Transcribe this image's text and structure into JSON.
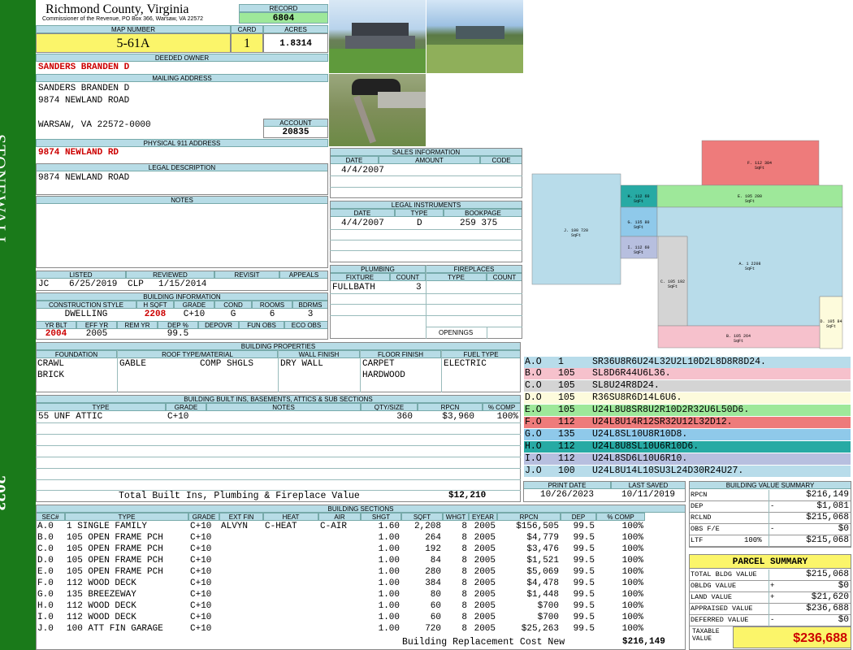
{
  "header": {
    "county": "Richmond County, Virginia",
    "commissioner": "Commissioner of the Revenue, PO Box 366, Warsaw, VA 22572",
    "record_label": "RECORD",
    "record": "6804",
    "map_label": "MAP NUMBER",
    "map_number": "5-61A",
    "card_label": "CARD",
    "card": "1",
    "acres_label": "ACRES",
    "acres": "1.8314"
  },
  "sidebar": {
    "district": "STONEWALL",
    "year": "2023"
  },
  "owner": {
    "owner_label": "DEEDED OWNER",
    "owner": "SANDERS BRANDEN D",
    "mailing_label": "MAILING ADDRESS",
    "mail1": "SANDERS BRANDEN D",
    "mail2": "9874 NEWLAND ROAD",
    "mail3": "WARSAW, VA 22572-0000",
    "account_label": "ACCOUNT",
    "account": "20835",
    "physical_label": "PHYSICAL 911 ADDRESS",
    "physical": "9874 NEWLAND RD",
    "legal_label": "LEGAL DESCRIPTION",
    "legal": "9874 NEWLAND ROAD",
    "notes_label": "NOTES"
  },
  "sales": {
    "title": "SALES INFORMATION",
    "cols": [
      "DATE",
      "AMOUNT",
      "CODE"
    ],
    "date": "4/4/2007"
  },
  "legal_instruments": {
    "title": "LEGAL INSTRUMENTS",
    "cols": [
      "DATE",
      "TYPE",
      "BOOKPAGE"
    ],
    "date": "4/4/2007",
    "type": "D",
    "bookpage": "259 375"
  },
  "plumbing": {
    "title": "PLUMBING",
    "cols": [
      "FIXTURE",
      "COUNT"
    ],
    "fixture": "FULLBATH",
    "count": "3"
  },
  "fireplaces": {
    "title": "FIREPLACES",
    "cols": [
      "TYPE",
      "COUNT"
    ],
    "openings": "OPENINGS"
  },
  "listing": {
    "listed_label": "LISTED",
    "listed_by": "JC",
    "listed_date": "6/25/2019",
    "reviewed_label": "REVIEWED",
    "reviewed_by": "CLP",
    "reviewed_date": "1/15/2014",
    "revisit_label": "REVISIT",
    "appeals_label": "APPEALS"
  },
  "building_info": {
    "title": "BUILDING INFORMATION",
    "cols": [
      "CONSTRUCTION STYLE",
      "H SQFT",
      "GRADE",
      "COND",
      "ROOMS",
      "BDRMS"
    ],
    "style": "DWELLING",
    "hsqft": "2208",
    "grade": "C+10",
    "cond": "G",
    "rooms": "6",
    "bdrms": "3",
    "cols2": [
      "YR BLT",
      "EFF YR",
      "REM YR",
      "DEP %",
      "DEPOVR",
      "FUN OBS",
      "ECO OBS"
    ],
    "yr_blt": "2004",
    "eff_yr": "2005",
    "dep": "99.5"
  },
  "properties": {
    "title": "BUILDING PROPERTIES",
    "cols": [
      "FOUNDATION",
      "ROOF TYPE/MATERIAL",
      "WALL FINISH",
      "FLOOR FINISH",
      "FUEL TYPE"
    ],
    "foundation1": "CRAWL",
    "foundation2": "BRICK",
    "roof_type": "GABLE",
    "roof_mat": "COMP SHGLS",
    "wall": "DRY WALL",
    "floor1": "CARPET",
    "floor2": "HARDWOOD",
    "fuel": "ELECTRIC"
  },
  "builtins": {
    "title": "BUILDING BUILT INS, BASEMENTS, ATTICS & SUB SECTIONS",
    "cols": [
      "TYPE",
      "GRADE",
      "NOTES",
      "QTY/SIZE",
      "RPCN",
      "% COMP"
    ],
    "row": {
      "type": "55 UNF ATTIC",
      "grade": "C+10",
      "qty": "360",
      "rpcn": "$3,960",
      "comp": "100%"
    },
    "total_label": "Total Built Ins, Plumbing & Fireplace Value",
    "total": "$12,210"
  },
  "dates": {
    "print_label": "PRINT DATE",
    "print": "10/26/2023",
    "saved_label": "LAST SAVED",
    "saved": "10/11/2019"
  },
  "segments": [
    {
      "code": "A.O",
      "type": "1",
      "vectors": "SR36U8R6U24L32U2L10D2L8D8R8D24.",
      "color": "#b8dcea"
    },
    {
      "code": "B.O",
      "type": "105",
      "vectors": "SL8D6R44U6L36.",
      "color": "#f6c1cc"
    },
    {
      "code": "C.O",
      "type": "105",
      "vectors": "SL8U24R8D24.",
      "color": "#d4d4d4"
    },
    {
      "code": "D.O",
      "type": "105",
      "vectors": "R36SU8R6D14L6U6.",
      "color": "#fdfbdc"
    },
    {
      "code": "E.O",
      "type": "105",
      "vectors": "U24L8U8SR8U2R10D2R32U6L50D6.",
      "color": "#9ee89a"
    },
    {
      "code": "F.O",
      "type": "112",
      "vectors": "U24L8U14R12SR32U12L32D12.",
      "color": "#ee7b7b"
    },
    {
      "code": "G.O",
      "type": "135",
      "vectors": "U24L8SL10U8R10D8.",
      "color": "#8fc9ea"
    },
    {
      "code": "H.O",
      "type": "112",
      "vectors": "U24L8U8SL10U6R10D6.",
      "color": "#27aaa4"
    },
    {
      "code": "I.O",
      "type": "112",
      "vectors": "U24L8SD6L10U6R10.",
      "color": "#b7bfdf"
    },
    {
      "code": "J.O",
      "type": "100",
      "vectors": "U24L8U14L10SU3L24D30R24U27.",
      "color": "#b8dcea"
    }
  ],
  "sketch": {
    "labels": [
      {
        "id": "F",
        "text": "F. 112\n384 SqFt"
      },
      {
        "id": "H",
        "text": "H. 112\n60 SqFt"
      },
      {
        "id": "E",
        "text": "E. 105\n280 SqFt"
      },
      {
        "id": "J",
        "text": "J. 100\n720 SqFt"
      },
      {
        "id": "G",
        "text": "G. 135\n80 SqFt"
      },
      {
        "id": "I",
        "text": "I. 112\n60 SqFt"
      },
      {
        "id": "A",
        "text": "A. 1\n2208 SqFt"
      },
      {
        "id": "C",
        "text": "C. 105\n192 SqFt"
      },
      {
        "id": "D",
        "text": "D. 105\n84 SqFt"
      },
      {
        "id": "B",
        "text": "B. 105\n264 SqFt"
      }
    ]
  },
  "sections": {
    "title": "BUILDING SECTIONS",
    "cols": [
      "SEC#",
      "TYPE",
      "GRADE",
      "EXT FIN",
      "HEAT",
      "AIR",
      "SHGT",
      "SQFT",
      "WHGT",
      "EYEAR",
      "RPCN",
      "DEP",
      "% COMP"
    ],
    "rows": [
      [
        "A.0",
        "1 SINGLE FAMILY",
        "C+10",
        "ALVYN",
        "C-HEAT",
        "C-AIR",
        "1.60",
        "2,208",
        "8",
        "2005",
        "$156,505",
        "99.5",
        "100%"
      ],
      [
        "B.0",
        "105 OPEN FRAME PCH",
        "C+10",
        "",
        "",
        "",
        "1.00",
        "264",
        "8",
        "2005",
        "$4,779",
        "99.5",
        "100%"
      ],
      [
        "C.0",
        "105 OPEN FRAME PCH",
        "C+10",
        "",
        "",
        "",
        "1.00",
        "192",
        "8",
        "2005",
        "$3,476",
        "99.5",
        "100%"
      ],
      [
        "D.0",
        "105 OPEN FRAME PCH",
        "C+10",
        "",
        "",
        "",
        "1.00",
        "84",
        "8",
        "2005",
        "$1,521",
        "99.5",
        "100%"
      ],
      [
        "E.0",
        "105 OPEN FRAME PCH",
        "C+10",
        "",
        "",
        "",
        "1.00",
        "280",
        "8",
        "2005",
        "$5,069",
        "99.5",
        "100%"
      ],
      [
        "F.0",
        "112 WOOD DECK",
        "C+10",
        "",
        "",
        "",
        "1.00",
        "384",
        "8",
        "2005",
        "$4,478",
        "99.5",
        "100%"
      ],
      [
        "G.0",
        "135 BREEZEWAY",
        "C+10",
        "",
        "",
        "",
        "1.00",
        "80",
        "8",
        "2005",
        "$1,448",
        "99.5",
        "100%"
      ],
      [
        "H.0",
        "112 WOOD DECK",
        "C+10",
        "",
        "",
        "",
        "1.00",
        "60",
        "8",
        "2005",
        "$700",
        "99.5",
        "100%"
      ],
      [
        "I.0",
        "112 WOOD DECK",
        "C+10",
        "",
        "",
        "",
        "1.00",
        "60",
        "8",
        "2005",
        "$700",
        "99.5",
        "100%"
      ],
      [
        "J.0",
        "100 ATT FIN GARAGE",
        "C+10",
        "",
        "",
        "",
        "1.00",
        "720",
        "8",
        "2005",
        "$25,263",
        "99.5",
        "100%"
      ]
    ],
    "total_label": "Building Replacement Cost New",
    "total": "$216,149"
  },
  "value_summary": {
    "title": "BUILDING VALUE SUMMARY",
    "rpcn_label": "RPCN",
    "rpcn": "$216,149",
    "dep_label": "DEP",
    "dep_sign": "-",
    "dep": "$1,081",
    "rclnd_label": "RCLND",
    "rclnd": "$215,068",
    "obs_label": "OBS F/E",
    "obs_sign": "-",
    "obs": "$0",
    "ltf_label": "LTF",
    "ltf_pct": "100%",
    "ltf": "$215,068"
  },
  "parcel": {
    "title": "PARCEL SUMMARY",
    "total_bldg_label": "TOTAL BLDG VALUE",
    "total_bldg": "$215,068",
    "obldg_label": "OBLDG VALUE",
    "obldg_sign": "+",
    "obldg": "$0",
    "land_label": "LAND VALUE",
    "land_sign": "+",
    "land": "$21,620",
    "appraised_label": "APPRAISED VALUE",
    "appraised": "$236,688",
    "deferred_label": "DEFERRED VALUE",
    "deferred_sign": "-",
    "deferred": "$0",
    "taxable_label1": "TAXABLE",
    "taxable_label2": "VALUE",
    "taxable": "$236,688"
  }
}
